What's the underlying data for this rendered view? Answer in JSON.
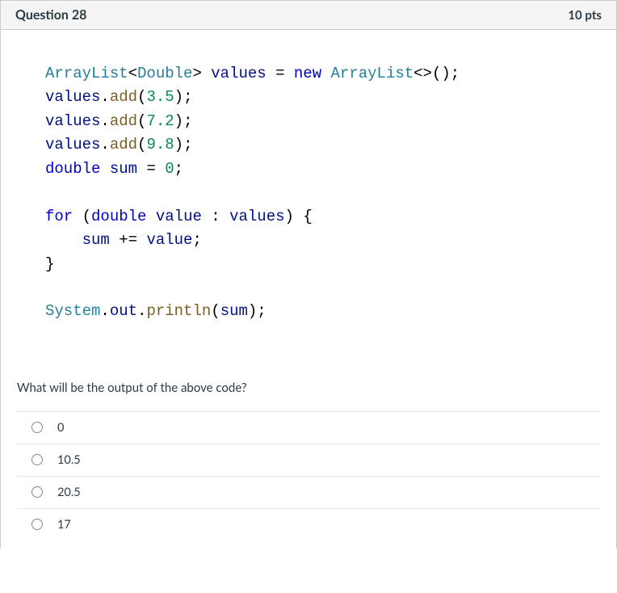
{
  "header": {
    "title": "Question 28",
    "points": "10 pts"
  },
  "code": {
    "l1a": "ArrayList",
    "l1b": "<",
    "l1c": "Double",
    "l1d": "> ",
    "l1e": "values",
    "l1f": " = ",
    "l1g": "new",
    "l1h": " ",
    "l1i": "ArrayList",
    "l1j": "<>();",
    "l2a": "values",
    "l2b": ".",
    "l2c": "add",
    "l2d": "(",
    "l2e": "3.5",
    "l2f": ");",
    "l3a": "values",
    "l3b": ".",
    "l3c": "add",
    "l3d": "(",
    "l3e": "7.2",
    "l3f": ");",
    "l4a": "values",
    "l4b": ".",
    "l4c": "add",
    "l4d": "(",
    "l4e": "9.8",
    "l4f": ");",
    "l5a": "double",
    "l5b": " ",
    "l5c": "sum",
    "l5d": " = ",
    "l5e": "0",
    "l5f": ";",
    "l6a": "for",
    "l6b": " (",
    "l6c": "double",
    "l6d": " ",
    "l6e": "value",
    "l6f": " : ",
    "l6g": "values",
    "l6h": ") {",
    "l7a": "    ",
    "l7b": "sum",
    "l7c": " += ",
    "l7d": "value",
    "l7e": ";",
    "l8a": "}",
    "l9a": "System",
    "l9b": ".",
    "l9c": "out",
    "l9d": ".",
    "l9e": "println",
    "l9f": "(",
    "l9g": "sum",
    "l9h": ");"
  },
  "prompt": "What will be the output of the above code?",
  "answers": [
    "0",
    "10.5",
    "20.5",
    "17"
  ]
}
